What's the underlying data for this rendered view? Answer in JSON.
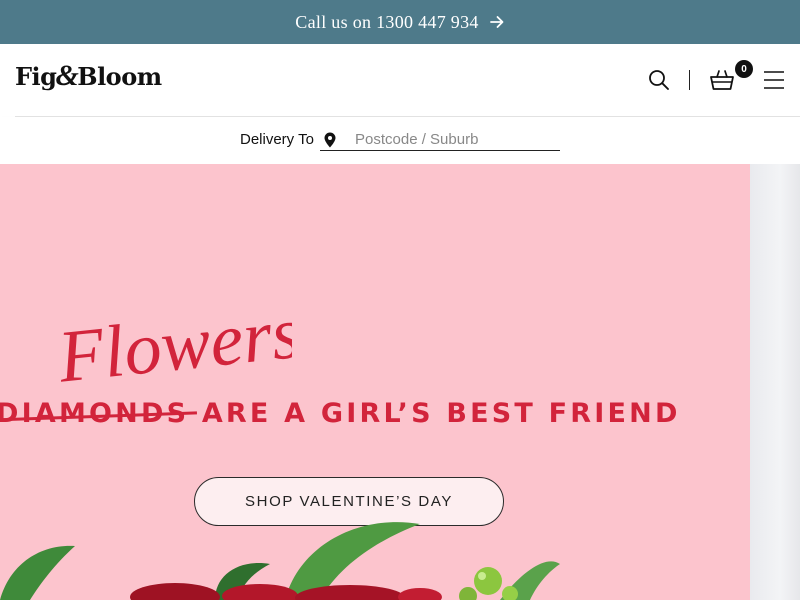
{
  "announcement": {
    "text": "Call us on 1300 447 934",
    "icon": "arrow-right-icon"
  },
  "header": {
    "logo_left": "Fig",
    "logo_amp": "&",
    "logo_right": "Bloom",
    "icons": [
      "search-icon",
      "cart-icon",
      "menu-icon"
    ],
    "cart_count": "0"
  },
  "delivery": {
    "label": "Delivery To",
    "placeholder": "Postcode / Suburb",
    "icon": "location-pin-icon"
  },
  "hero": {
    "script_word": "Flowers",
    "struck_word": "DIAMONDS",
    "tagline_rest": " ARE A GIRL’S BEST FRIEND",
    "cta_label": "SHOP VALENTINE’S DAY",
    "colors": {
      "background": "#fcc4cd",
      "accent_red": "#d2243b"
    }
  },
  "colors": {
    "announcement_bar": "#4e7a8a"
  }
}
